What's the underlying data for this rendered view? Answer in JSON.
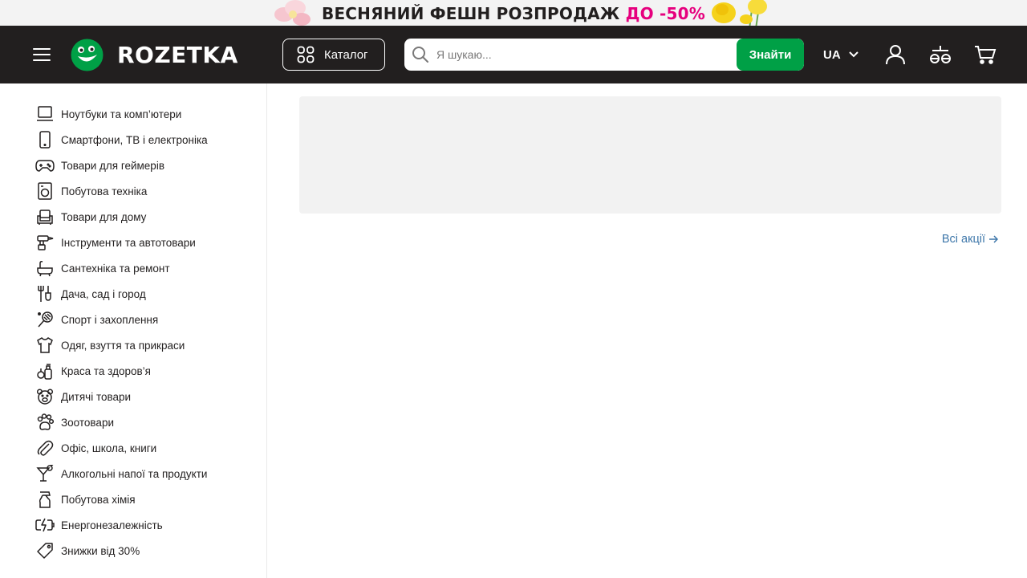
{
  "promo": {
    "text_main": "ВЕСНЯНИЙ ФЕШН РОЗПРОДАЖ",
    "text_accent": "ДО -50%",
    "accent_color": "#e6007e"
  },
  "header": {
    "brand": "ROZETKA",
    "catalog_label": "Каталог",
    "search_placeholder": "Я шукаю...",
    "search_button": "Знайти",
    "language": "UA",
    "bg_color": "#221f1f",
    "accent_color": "#00a046"
  },
  "sidebar": {
    "items": [
      {
        "label": "Ноутбуки та комп’ютери",
        "icon": "laptop-icon"
      },
      {
        "label": "Смартфони, ТВ і електроніка",
        "icon": "smartphone-icon"
      },
      {
        "label": "Товари для геймерів",
        "icon": "gamepad-icon"
      },
      {
        "label": "Побутова техніка",
        "icon": "washing-machine-icon"
      },
      {
        "label": "Товари для дому",
        "icon": "armchair-icon"
      },
      {
        "label": "Інструменти та автотовари",
        "icon": "drill-icon"
      },
      {
        "label": "Сантехніка та ремонт",
        "icon": "bathtub-icon"
      },
      {
        "label": "Дача, сад і город",
        "icon": "garden-tools-icon"
      },
      {
        "label": "Спорт і захоплення",
        "icon": "racket-icon"
      },
      {
        "label": "Одяг, взуття та прикраси",
        "icon": "tshirt-icon"
      },
      {
        "label": "Краса та здоров’я",
        "icon": "perfume-icon"
      },
      {
        "label": "Дитячі товари",
        "icon": "teddy-bear-icon"
      },
      {
        "label": "Зоотовари",
        "icon": "paw-icon"
      },
      {
        "label": "Офіс, школа, книги",
        "icon": "paperclip-icon"
      },
      {
        "label": "Алкогольні напої та продукти",
        "icon": "cocktail-icon"
      },
      {
        "label": "Побутова хімія",
        "icon": "spray-bottle-icon"
      },
      {
        "label": "Енергонезалежність",
        "icon": "battery-charge-icon"
      },
      {
        "label": "Знижки від 30%",
        "icon": "price-tag-icon"
      }
    ]
  },
  "main": {
    "all_promos_link": "Всі акції"
  }
}
